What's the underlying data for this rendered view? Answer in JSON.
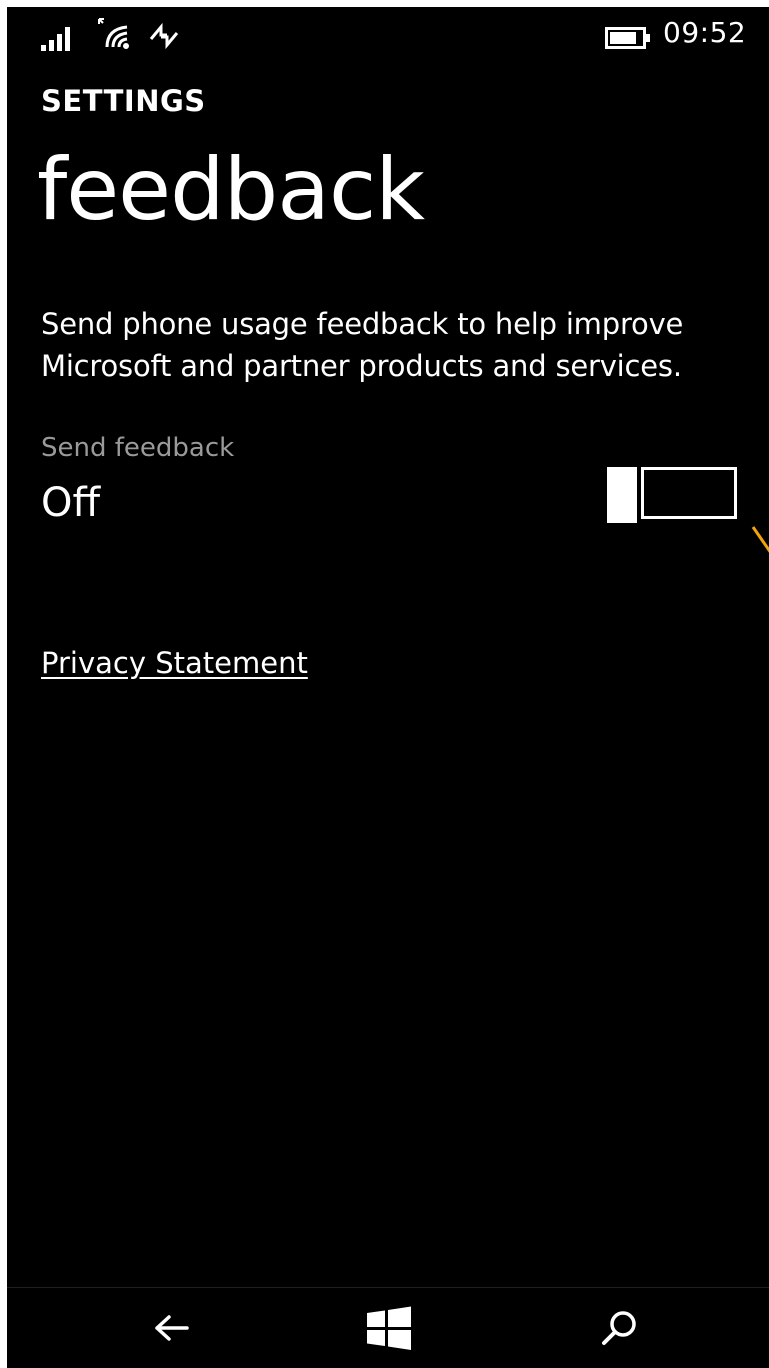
{
  "status_bar": {
    "time": "09:52",
    "icons": [
      "signal-bars-icon",
      "wifi-icon",
      "data-sync-icon",
      "battery-icon"
    ]
  },
  "header": {
    "app_title": "SETTINGS",
    "page_title": "feedback"
  },
  "main": {
    "description": "Send phone usage feedback to help improve Microsoft and partner products and services.",
    "send_feedback": {
      "label": "Send feedback",
      "state": "Off",
      "on": false
    },
    "privacy_link": "Privacy Statement"
  },
  "nav_bar": {
    "buttons": [
      "back-arrow-icon",
      "windows-logo-icon",
      "search-icon"
    ]
  },
  "colors": {
    "background": "#000000",
    "foreground": "#ffffff",
    "secondary_text": "#9a9a9a",
    "accent": "#f0a30a"
  }
}
